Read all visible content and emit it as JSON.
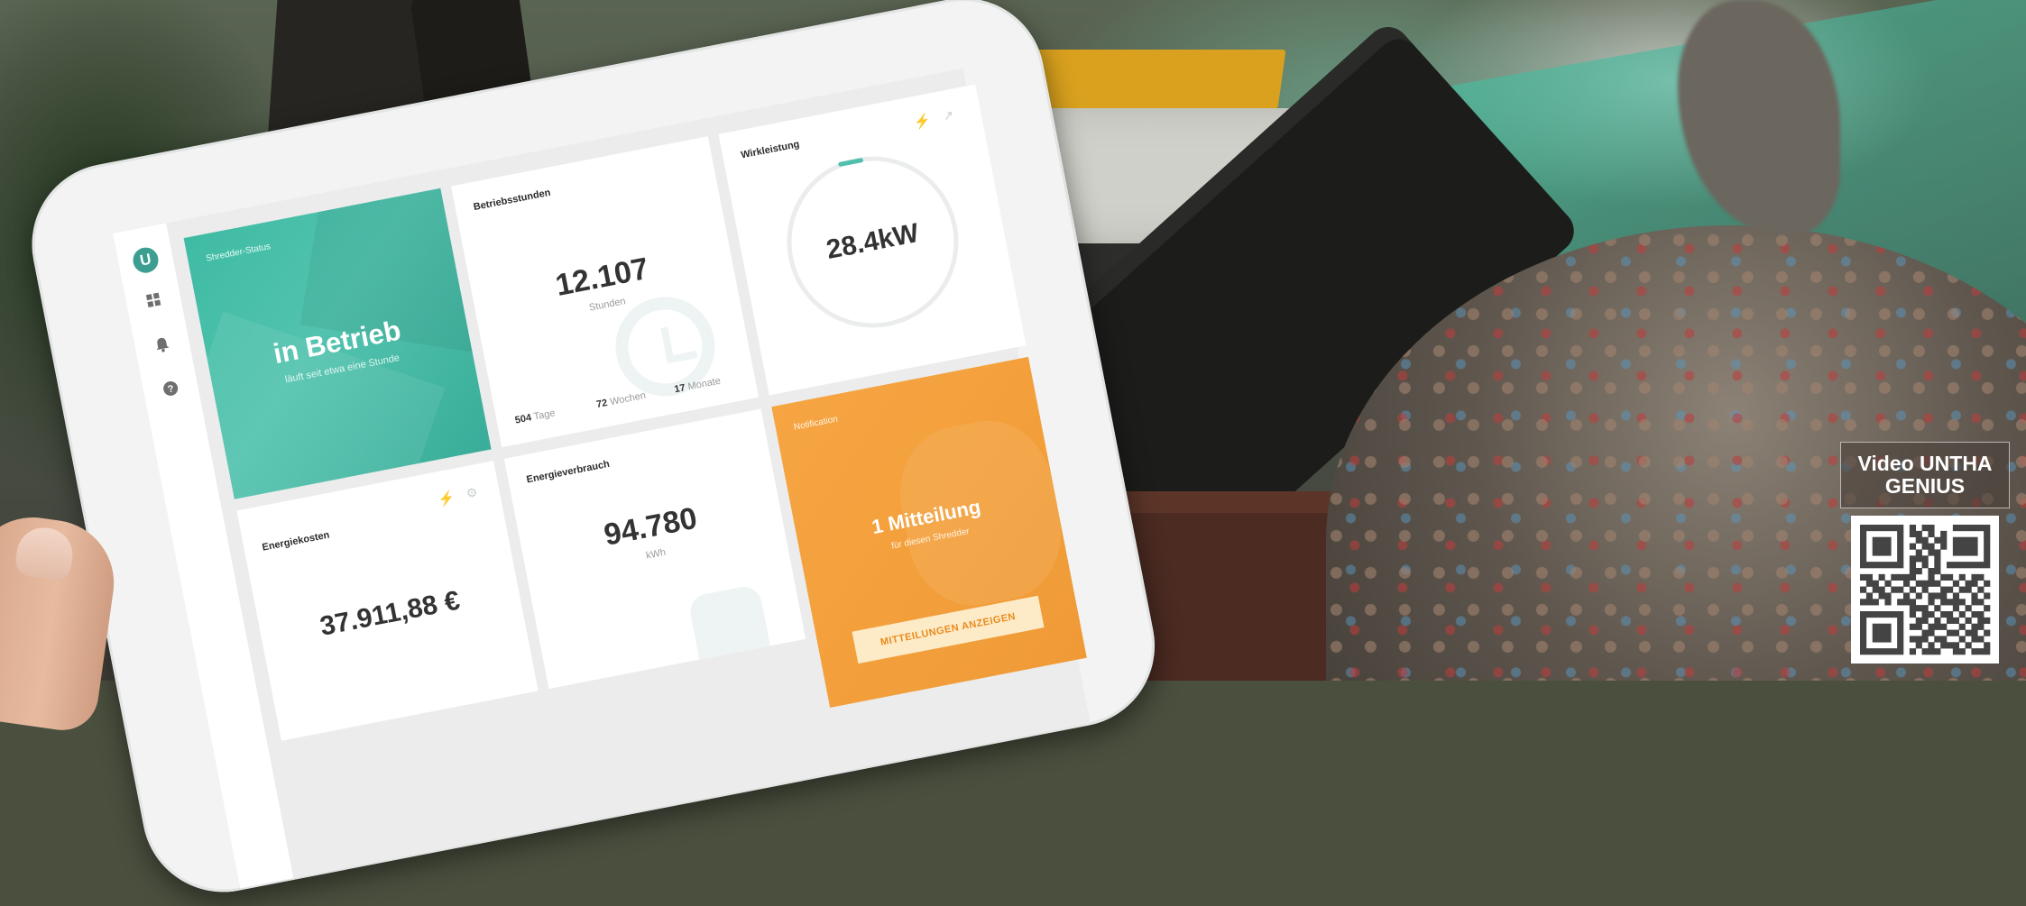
{
  "colors": {
    "teal": "#3fbba4",
    "orange": "#f3a03c",
    "qr": "#444444"
  },
  "sidebar": {
    "logo_letter": "U",
    "icons": [
      "grid-icon",
      "bell-icon",
      "help-icon"
    ]
  },
  "dashboard": {
    "status_card": {
      "title": "Shredder-Status",
      "value": "in Betrieb",
      "subtitle": "läuft seit etwa eine Stunde"
    },
    "hours_card": {
      "title": "Betriebsstunden",
      "value": "12.107",
      "unit": "Stunden",
      "days_value": "504",
      "days_label": "Tage",
      "weeks_value": "72",
      "weeks_label": "Wochen",
      "months_value": "17",
      "months_label": "Monate"
    },
    "power_card": {
      "title": "Wirkleistung",
      "value": "28.4kW"
    },
    "costs_card": {
      "title": "Energiekosten",
      "value": "37.911,88 €"
    },
    "energy_card": {
      "title": "Energieverbrauch",
      "value": "94.780",
      "unit": "kWh"
    },
    "notification_card": {
      "title": "Notification",
      "value": "1 Mitteilung",
      "subtitle": "für diesen Shredder",
      "button_label": "MITTEILUNGEN ANZEIGEN"
    }
  },
  "qr_panel": {
    "label_line1": "Video UNTHA",
    "label_line2": "GENIUS",
    "modules": [
      "111111101011000111111",
      "100000101101010000001",
      "101110100110110111101",
      "101110101011010111101",
      "101110100101100111101",
      "100000101110100000001",
      "111111101010101111111",
      "000000001101100000000",
      "110101111001011010110",
      "011010010111100101101",
      "101101101010011011010",
      "010110010101110100101",
      "111010111001011110110",
      "000000001110100101001",
      "111111101011011010110",
      "100000100110101101011",
      "101110101101110010110",
      "101110100011001101101",
      "101110101110110010110",
      "100000100101011101001",
      "111111101011100110111"
    ]
  }
}
